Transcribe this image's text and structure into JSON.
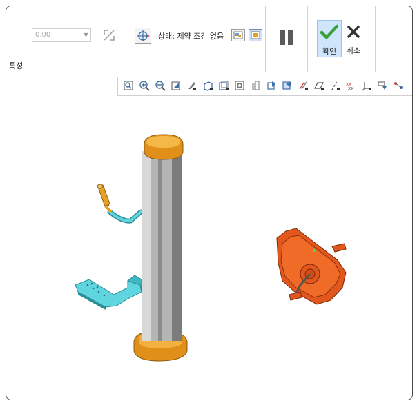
{
  "dashboard": {
    "value_field": "0.00",
    "status_text": "상태: 제약 조건 없음",
    "confirm_label": "확인",
    "cancel_label": "취소",
    "tab_label": "특성"
  },
  "icons": {
    "flip": "flip-direction-icon",
    "csys": "coordinate-system-icon",
    "status_a": "status-display-icon",
    "status_b": "status-toggle-icon",
    "pause": "pause-icon",
    "confirm": "check-icon",
    "cancel": "close-icon"
  },
  "view_toolbar": [
    "refit-icon",
    "zoom-in-icon",
    "zoom-out-icon",
    "repaint-icon",
    "view-style-icon",
    "saved-orientation-icon",
    "view-manager-icon",
    "perspective-icon",
    "section-icon",
    "display-icon",
    "spin-center-icon",
    "annotation-icon",
    "plane-display-icon",
    "axis-display-icon",
    "point-display-icon",
    "csys-display-icon",
    "tag-display-icon",
    "more-display-icon"
  ],
  "colors": {
    "confirm_green": "#3aa23a",
    "selected_blue": "#cfe5fb",
    "part_orange": "#e8a020",
    "part_red_orange": "#e2571e",
    "part_cyan": "#5fd6df",
    "column_gray": "#a8a8a8"
  }
}
